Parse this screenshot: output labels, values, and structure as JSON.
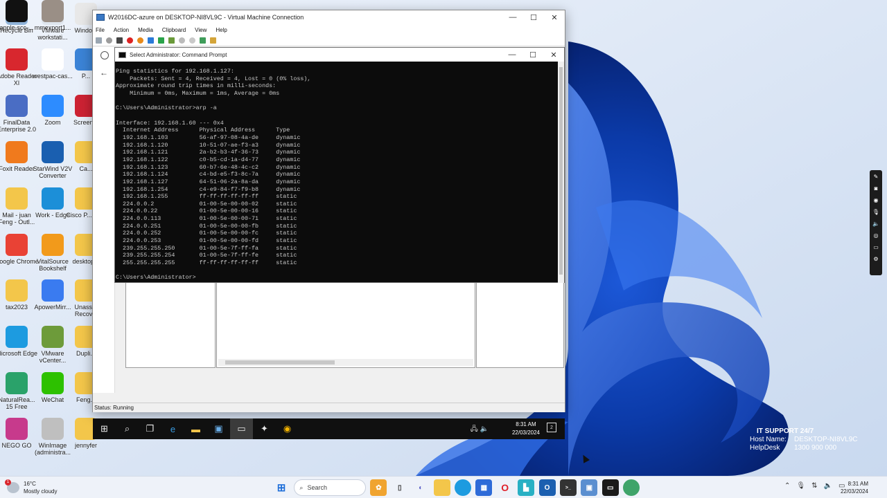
{
  "desktop": {
    "icons": [
      {
        "label": "Recycle Bin",
        "color": "#8fb3d9"
      },
      {
        "label": "VMware workstati...",
        "color": "#dfe6ee"
      },
      {
        "label": "Windo...",
        "color": "#e8e8e8"
      },
      {
        "label": "Adobe Reader XI",
        "color": "#d8272e"
      },
      {
        "label": "westpac-cas...",
        "color": "#ffffff"
      },
      {
        "label": "P...",
        "color": "#3b83d6"
      },
      {
        "label": "FinalData Enterprise 2.0",
        "color": "#4a6dc4"
      },
      {
        "label": "Zoom",
        "color": "#2d8cff"
      },
      {
        "label": "Screen...",
        "color": "#cc2233"
      },
      {
        "label": "Foxit Reader",
        "color": "#f07a1d"
      },
      {
        "label": "StarWind V2V Converter",
        "color": "#1a5fb0"
      },
      {
        "label": "Ca...",
        "color": "#f3c64a"
      },
      {
        "label": "Mail - juan Feng - Outl...",
        "color": "#f3c64a"
      },
      {
        "label": "Work - Edge",
        "color": "#1c8fd8"
      },
      {
        "label": "Cisco P... 30...",
        "color": "#f3c64a"
      },
      {
        "label": "Google Chrome",
        "color": "#e94235"
      },
      {
        "label": "VitalSource Bookshelf",
        "color": "#f29a1b"
      },
      {
        "label": "desktop...",
        "color": "#f3c64a"
      },
      {
        "label": "tax2023",
        "color": "#f3c64a"
      },
      {
        "label": "ApowerMirr...",
        "color": "#3a7bf0"
      },
      {
        "label": "Unass... Recov...",
        "color": "#f3c64a"
      },
      {
        "label": "Microsoft Edge",
        "color": "#1d9be0"
      },
      {
        "label": "VMware vCenter...",
        "color": "#6d9b3a"
      },
      {
        "label": "Dupli...",
        "color": "#f3c64a"
      },
      {
        "label": "NaturalRea... 15 Free",
        "color": "#2aa26a"
      },
      {
        "label": "WeChat",
        "color": "#2dc100"
      },
      {
        "label": "Feng...",
        "color": "#f3c64a"
      },
      {
        "label": "NEGO GO",
        "color": "#c73a8c"
      },
      {
        "label": "WinImage (administra...",
        "color": "#bfbfbf"
      },
      {
        "label": "jennyfer",
        "color": "#f3c64a"
      },
      {
        "label": "apple-scc-...",
        "color": "#111111"
      },
      {
        "label": "mmexport1...",
        "color": "#9a8f86"
      }
    ]
  },
  "vm_window": {
    "title": "W2016DC-azure on DESKTOP-NI8VL9C - Virtual Machine Connection",
    "menu": [
      "File",
      "Action",
      "Media",
      "Clipboard",
      "View",
      "Help"
    ],
    "status": "Status: Running"
  },
  "cmd_window": {
    "title": "Select Administrator: Command Prompt",
    "lines": [
      "Ping statistics for 192.168.1.127:",
      "    Packets: Sent = 4, Received = 4, Lost = 0 (0% loss),",
      "Approximate round trip times in milli-seconds:",
      "    Minimum = 0ms, Maximum = 1ms, Average = 0ms",
      "",
      "C:\\Users\\Administrator>arp -a",
      "",
      "Interface: 192.168.1.60 --- 0x4",
      "  Internet Address      Physical Address      Type",
      "  192.168.1.103         56-af-97-08-4a-de     dynamic",
      "  192.168.1.120         10-51-07-ae-f3-a3     dynamic",
      "  192.168.1.121         2a-b2-b3-4f-36-73     dynamic",
      "  192.168.1.122         c0-b5-cd-1a-d4-77     dynamic",
      "  192.168.1.123         60-b7-6e-48-4c-c2     dynamic",
      "  192.168.1.124         c4-bd-e5-f3-8c-7a     dynamic",
      "  192.168.1.127         64-51-06-2a-8a-da     dynamic",
      "  192.168.1.254         c4-e9-84-f7-f9-b8     dynamic",
      "  192.168.1.255         ff-ff-ff-ff-ff-ff     static",
      "  224.0.0.2             01-00-5e-00-00-02     static",
      "  224.0.0.22            01-00-5e-00-00-16     static",
      "  224.0.0.113           01-00-5e-00-00-71     static",
      "  224.0.0.251           01-00-5e-00-00-fb     static",
      "  224.0.0.252           01-00-5e-00-00-fc     static",
      "  224.0.0.253           01-00-5e-00-00-fd     static",
      "  239.255.255.250       01-00-5e-7f-ff-fa     static",
      "  239.255.255.254       01-00-5e-7f-ff-fe     static",
      "  255.255.255.255       ff-ff-ff-ff-ff-ff     static",
      "",
      "C:\\Users\\Administrator>"
    ]
  },
  "guest_taskbar": {
    "time": "8:31 AM",
    "date": "22/03/2024",
    "notifications": "2"
  },
  "it_support": {
    "heading": "IT SUPPORT 24/7",
    "host_label": "Host Name:",
    "host_value": "DESKTOP-NI8VL9C",
    "help_label": "HelpDesk",
    "help_value": "1300 900 000"
  },
  "host_taskbar": {
    "weather_temp": "16°C",
    "weather_desc": "Mostly cloudy",
    "weather_badge": "1",
    "search_placeholder": "Search",
    "time": "8:31 AM",
    "date": "22/03/2024"
  }
}
